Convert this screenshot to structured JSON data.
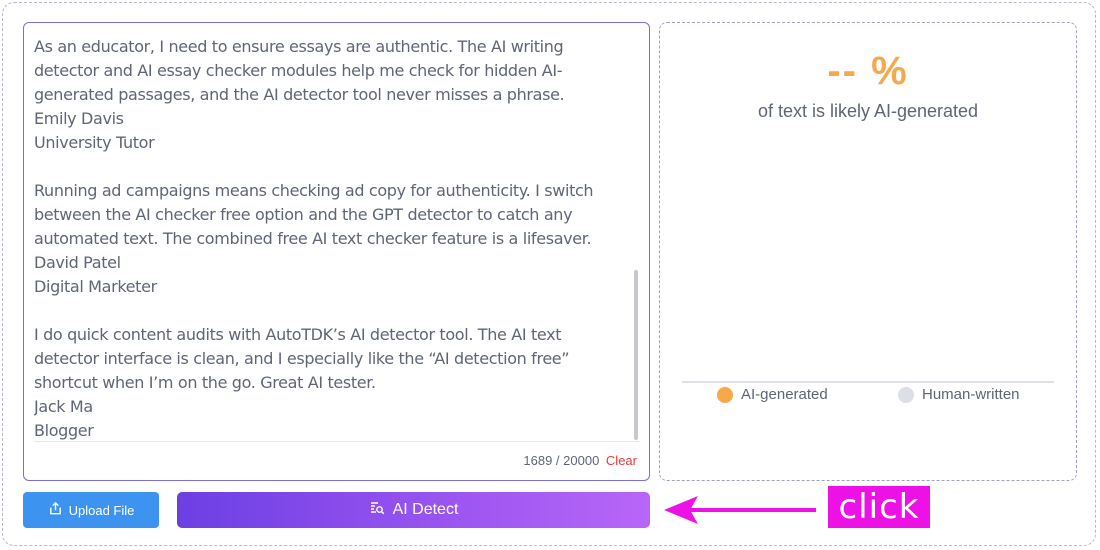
{
  "editor": {
    "text": "As an educator, I need to ensure essays are authentic. The AI writing detector and AI essay checker modules help me check for hidden AI-generated passages, and the AI detector tool never misses a phrase.\nEmily Davis\nUniversity Tutor\n\nRunning ad campaigns means checking ad copy for authenticity. I switch between the AI checker free option and the GPT detector to catch any automated text. The combined free AI text checker feature is a lifesaver.\nDavid Patel\nDigital Marketer\n\nI do quick content audits with AutoTDK’s AI detector tool. The AI text detector interface is clean, and I especially like the “AI detection free” shortcut when I’m on the go. Great AI tester.\nJack Ma\nBlogger",
    "char_count": "1689 / 20000",
    "clear_label": "Clear"
  },
  "result": {
    "percent": "-- %",
    "caption": "of text is likely AI-generated",
    "legend_ai": "AI-generated",
    "legend_human": "Human-written",
    "colors": {
      "ai": "#f5a94b",
      "human": "#dcdfe6"
    }
  },
  "actions": {
    "upload_label": "Upload File",
    "detect_label": "AI Detect",
    "upload_icon": "upload-icon",
    "detect_icon": "scan-document-icon"
  },
  "annotation": {
    "click_label": "click",
    "color": "#ee11e5"
  }
}
